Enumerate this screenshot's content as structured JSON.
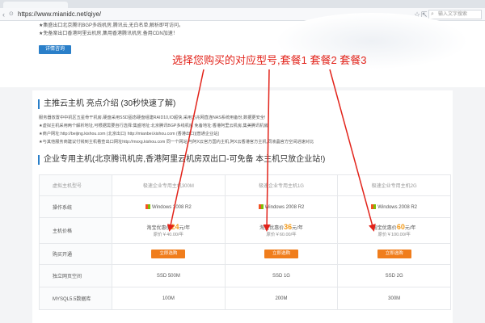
{
  "browser": {
    "url": "https://www.mianidc.net/qiye/",
    "search_placeholder": "输入文字搜索"
  },
  "banner": {
    "bullets": [
      "★集盛出口北京腾讯BGP多线机房,腾讯云,无白名单,解析即可访问。",
      "★免备案出口香港阿里云机房,集用香港腾讯机房,备用CDN加速！"
    ],
    "detail_button": "详情咨询"
  },
  "annotation": "选择您购买的对应型号,套餐1  套餐2  套餐3",
  "intro": {
    "title": "主推云主机 亮点介绍 (30秒快速了解)",
    "lines": [
      "服务器放置中中机区五星骨干机房,硬盘采用SSD固态硬盘组建RAID10,IO超快,采用万兆网直连NAS系统用备份,数据更安全!",
      "★虚拟主机采用两个解析地址,可根据需要自行选择:集盛地址:北京腾讯BGP多线机房 免备地址:香港阿里云机房,集美腾讯机房",
      "★商户网址:http://beijing.kishou.com (北京出口) http://mianbei.kishou.com (香港出口)[普通企业站]",
      "★与其他服务商建议付钱到主机看查出口网址http://mxxg.kishou.com 同一个网站,与阿X云官方国内主机,阿X云香港官方主机,同液晶官方空间进速对比"
    ]
  },
  "enterprise": {
    "title": "企业专用主机(北京腾讯机房,香港阿里云机房双出口-可免备 本主机只放企业站!)"
  },
  "table": {
    "header": [
      "虚拟主机型号",
      "极速企业专用主机300M",
      "极速企业专用主机1G",
      "极速企业专用主机2G"
    ],
    "rows": [
      {
        "label": "操作系统",
        "cells": [
          "Windows 2008 R2",
          "Windows 2008 R2",
          "Windows 2008 R2"
        ]
      },
      {
        "label": "主机价格",
        "prices": [
          {
            "prefix": "淘宝优惠价",
            "num": "24",
            "suffix": "元/年",
            "orig": "原价￥40.00/年"
          },
          {
            "prefix": "淘宝优惠价",
            "num": "36",
            "suffix": "元/年",
            "orig": "原价￥60.00/年"
          },
          {
            "prefix": "淘宝优惠价",
            "num": "60",
            "suffix": "元/年",
            "orig": "原价￥100.00/年"
          }
        ]
      },
      {
        "label": "购买开通",
        "buttons": [
          "立即选购",
          "立即选购",
          "立即选购"
        ]
      },
      {
        "label": "独立网页空间",
        "cells": [
          "SSD 500M",
          "SSD 1G",
          "SSD 2G"
        ]
      },
      {
        "label": "MYSQL5.5数据库",
        "cells": [
          "100M",
          "200M",
          "300M"
        ]
      }
    ]
  },
  "colors": {
    "accent_blue": "#2a7fc9",
    "buy_orange": "#f07d1c",
    "price_orange": "#f29a1a",
    "annotation_red": "#e2231a"
  }
}
